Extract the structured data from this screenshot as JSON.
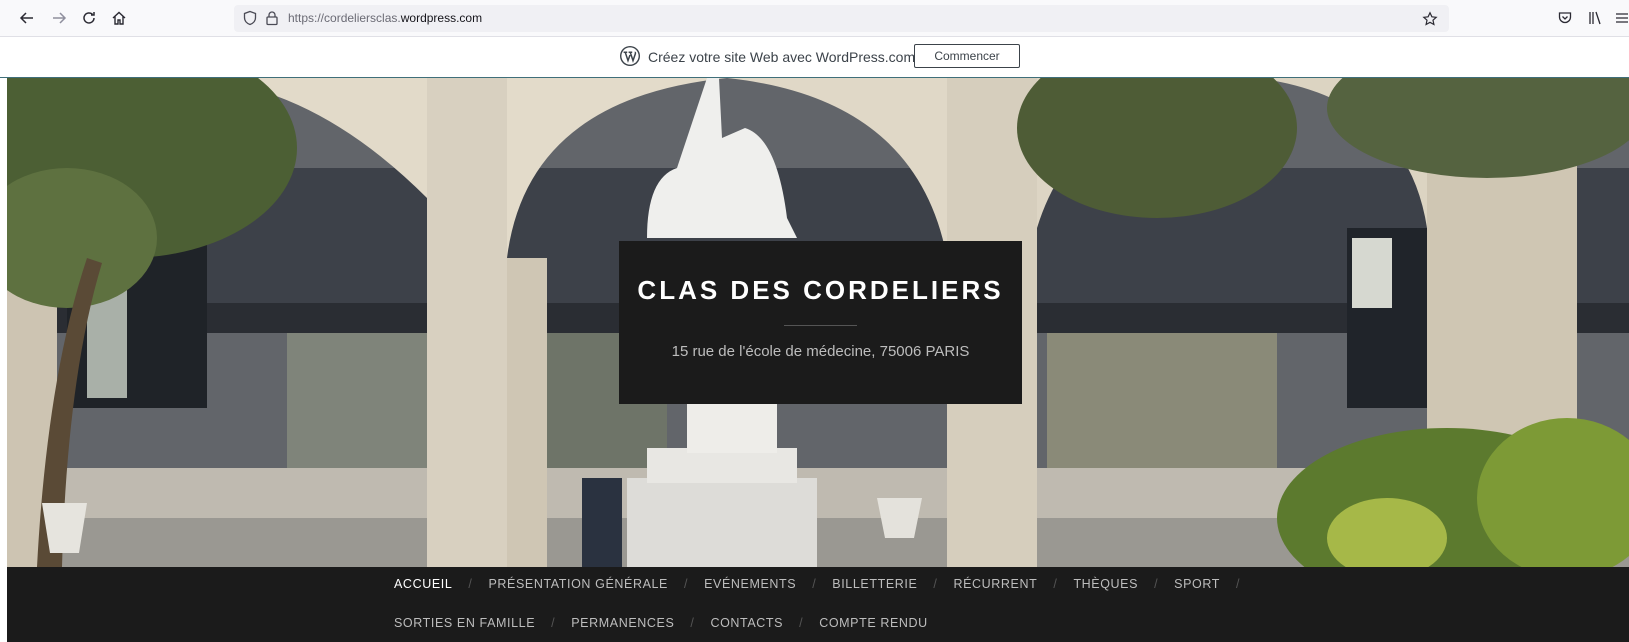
{
  "browser": {
    "url_prefix": "https://",
    "url_sub": "cordeliersclas.",
    "url_host": "wordpress.com"
  },
  "wp_banner": {
    "text": "Créez votre site Web avec WordPress.com",
    "button_label": "Commencer"
  },
  "site": {
    "title": "CLAS DES CORDELIERS",
    "description": "15 rue de l'école de médecine, 75006 PARIS"
  },
  "menu": {
    "row1": [
      "ACCUEIL",
      "PRÉSENTATION GÉNÉRALE",
      "EVÉNEMENTS",
      "BILLETTERIE",
      "RÉCURRENT",
      "THÈQUES",
      "SPORT"
    ],
    "row2": [
      "SORTIES EN FAMILLE",
      "PERMANENCES",
      "CONTACTS",
      "COMPTE RENDU"
    ],
    "separator": "/",
    "active": "ACCUEIL"
  },
  "colors": {
    "menu_bg": "#1b1b1b",
    "menu_text": "#bdbdbd",
    "menu_active": "#ffffff",
    "accent_border": "#3f6f7a"
  },
  "icons": {
    "back": "arrow-left-icon",
    "forward": "arrow-right-icon",
    "reload": "reload-icon",
    "home": "home-icon",
    "shield": "shield-icon",
    "lock": "lock-icon",
    "bookmark": "star-icon",
    "pocket": "pocket-icon",
    "library": "library-icon",
    "menu": "hamburger-icon",
    "wordpress": "wordpress-logo-icon"
  }
}
